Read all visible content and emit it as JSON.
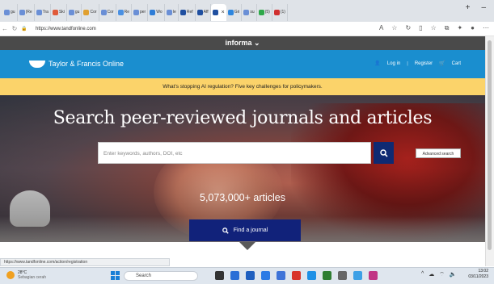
{
  "browser": {
    "tabs": [
      {
        "label": "gu",
        "color": "#6a8fd6"
      },
      {
        "label": "(Re",
        "color": "#6a8fd6"
      },
      {
        "label": "Tra",
        "color": "#6a8fd6"
      },
      {
        "label": "Ski",
        "color": "#e05a3a"
      },
      {
        "label": "gu",
        "color": "#6a8fd6"
      },
      {
        "label": "Cor",
        "color": "#e0a030"
      },
      {
        "label": "Cor",
        "color": "#6a8fd6"
      },
      {
        "label": "Re",
        "color": "#4a90e2"
      },
      {
        "label": "per",
        "color": "#6a8fd6"
      },
      {
        "label": "Wo",
        "color": "#2e7dd7"
      },
      {
        "label": "Ie",
        "color": "#6a8fd6"
      },
      {
        "label": "Ref",
        "color": "#1f4fa0"
      },
      {
        "label": "Aff",
        "color": "#1f4fa0"
      },
      {
        "label": "",
        "color": "#1f4fa0",
        "active": true
      },
      {
        "label": "Gri",
        "color": "#2e86de"
      },
      {
        "label": "su",
        "color": "#6a8fd6"
      },
      {
        "label": "(5)",
        "color": "#2ea84a"
      },
      {
        "label": "(1)",
        "color": "#d03030"
      }
    ],
    "new_tab": "+",
    "minimize": "–",
    "maximize": "☐",
    "url": "https://www.tandfonline.com"
  },
  "informa": {
    "label": "informa ⌄"
  },
  "header": {
    "logo_text": "Taylor & Francis Online",
    "login": "Log in",
    "register": "Register",
    "cart": "Cart"
  },
  "banner": {
    "text": "What's stopping AI regulation? Five key challenges for policymakers."
  },
  "hero": {
    "headline": "Search peer-reviewed journals and articles",
    "search_placeholder": "Enter keywords, authors, DOI, etc",
    "advanced_search": "Advanced search",
    "article_count": "5,073,000+ articles",
    "find_journal": "Find a journal"
  },
  "status_bar": {
    "url": "https://www.tandfonline.com/action/registration"
  },
  "taskbar": {
    "weather_temp": "28°C",
    "weather_desc": "Sebagian cerah",
    "search_label": "Search",
    "time": "13:02",
    "date": "03/11/2023"
  }
}
